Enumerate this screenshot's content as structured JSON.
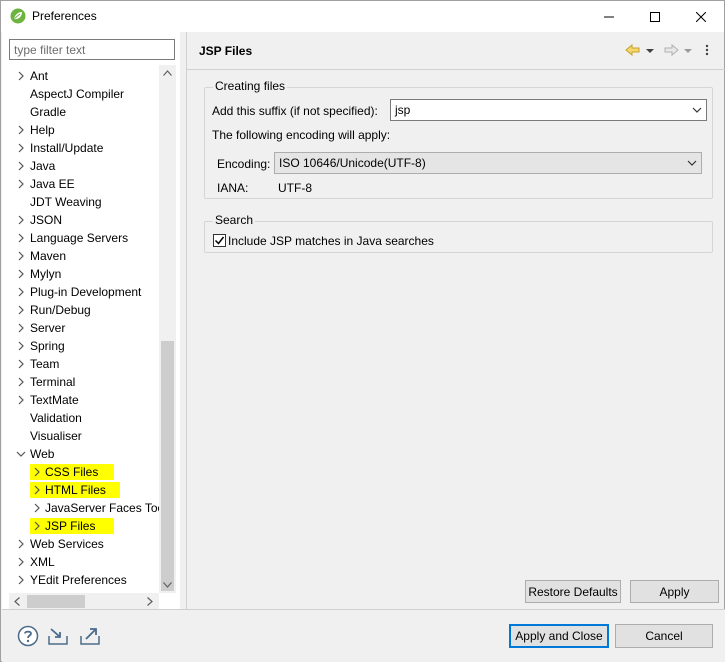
{
  "window": {
    "title": "Preferences"
  },
  "filter": {
    "placeholder": "type filter text"
  },
  "tree": [
    {
      "label": "Ant",
      "expandable": true
    },
    {
      "label": "AspectJ Compiler",
      "expandable": false
    },
    {
      "label": "Gradle",
      "expandable": false
    },
    {
      "label": "Help",
      "expandable": true
    },
    {
      "label": "Install/Update",
      "expandable": true
    },
    {
      "label": "Java",
      "expandable": true
    },
    {
      "label": "Java EE",
      "expandable": true
    },
    {
      "label": "JDT Weaving",
      "expandable": false
    },
    {
      "label": "JSON",
      "expandable": true
    },
    {
      "label": "Language Servers",
      "expandable": true
    },
    {
      "label": "Maven",
      "expandable": true
    },
    {
      "label": "Mylyn",
      "expandable": true
    },
    {
      "label": "Plug-in Development",
      "expandable": true
    },
    {
      "label": "Run/Debug",
      "expandable": true
    },
    {
      "label": "Server",
      "expandable": true
    },
    {
      "label": "Spring",
      "expandable": true
    },
    {
      "label": "Team",
      "expandable": true
    },
    {
      "label": "Terminal",
      "expandable": true
    },
    {
      "label": "TextMate",
      "expandable": true
    },
    {
      "label": "Validation",
      "expandable": false
    },
    {
      "label": "Visualiser",
      "expandable": false
    },
    {
      "label": "Web",
      "expandable": true,
      "expanded": true
    },
    {
      "label": "CSS Files",
      "expandable": true,
      "child": true,
      "highlighted": true
    },
    {
      "label": "HTML Files",
      "expandable": true,
      "child": true,
      "highlighted": true
    },
    {
      "label": "JavaServer Faces Too",
      "expandable": true,
      "child": true
    },
    {
      "label": "JSP Files",
      "expandable": true,
      "child": true,
      "highlighted": true,
      "selected": true
    },
    {
      "label": "Web Services",
      "expandable": true
    },
    {
      "label": "XML",
      "expandable": true
    },
    {
      "label": "YEdit Preferences",
      "expandable": true
    }
  ],
  "page": {
    "title": "JSP Files",
    "creating_files": {
      "legend": "Creating files",
      "suffix_label": "Add this suffix (if not specified):",
      "suffix_value": "jsp",
      "encoding_note": "The following encoding will apply:",
      "encoding_label": "Encoding:",
      "encoding_value": "ISO 10646/Unicode(UTF-8)",
      "iana_label": "IANA:",
      "iana_value": "UTF-8"
    },
    "search": {
      "legend": "Search",
      "include_label": "Include JSP matches in Java searches",
      "include_checked": true
    },
    "restore_defaults": "Restore Defaults",
    "apply": "Apply"
  },
  "footer": {
    "apply_close": "Apply and Close",
    "cancel": "Cancel"
  },
  "colors": {
    "highlight": "#ffff00",
    "nav_arrow": "#d4a017",
    "default_button_border": "#0078d7"
  }
}
